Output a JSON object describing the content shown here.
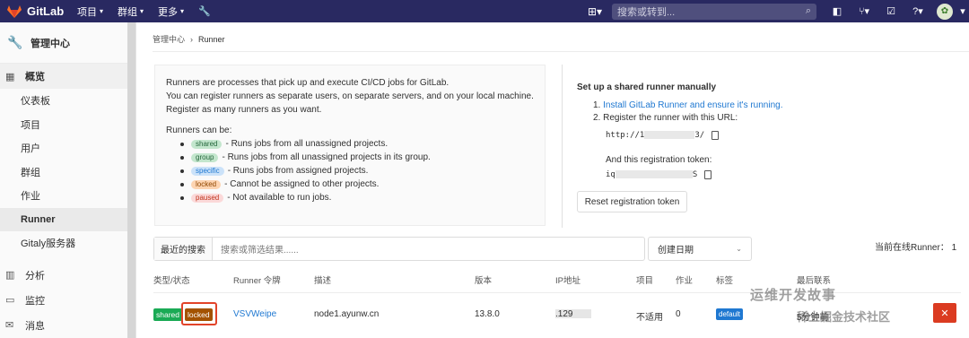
{
  "topbar": {
    "app_name": "GitLab",
    "menu": [
      {
        "label": "项目"
      },
      {
        "label": "群组"
      },
      {
        "label": "更多"
      }
    ],
    "search_placeholder": "搜索或转到..."
  },
  "sidebar": {
    "header": "管理中心",
    "section": "概览",
    "items": [
      {
        "label": "仪表板"
      },
      {
        "label": "项目"
      },
      {
        "label": "用户"
      },
      {
        "label": "群组"
      },
      {
        "label": "作业"
      },
      {
        "label": "Runner"
      },
      {
        "label": "Gitaly服务器"
      }
    ],
    "groups": [
      {
        "label": "分析"
      },
      {
        "label": "监控"
      },
      {
        "label": "消息"
      }
    ]
  },
  "breadcrumb": {
    "parent": "管理中心",
    "current": "Runner"
  },
  "info": {
    "line1": "Runners are processes that pick up and execute CI/CD jobs for GitLab.",
    "line2": "You can register runners as separate users, on separate servers, and on your local machine.",
    "line3": "Register as many runners as you want.",
    "can_be": "Runners can be:",
    "types": [
      {
        "badge": "shared",
        "text": "- Runs jobs from all unassigned projects."
      },
      {
        "badge": "group",
        "text": "- Runs jobs from all unassigned projects in its group."
      },
      {
        "badge": "specific",
        "text": "- Runs jobs from assigned projects."
      },
      {
        "badge": "locked",
        "text": "- Cannot be assigned to other projects."
      },
      {
        "badge": "paused",
        "text": "- Not available to run jobs."
      }
    ]
  },
  "setup": {
    "title": "Set up a shared runner manually",
    "step1_prefix": "1. ",
    "step1_link": "Install GitLab Runner and ensure it's running.",
    "step2": "2. Register the runner with this URL:",
    "url_start": "http://1",
    "url_end": "3/",
    "token_label": "And this registration token:",
    "token_start": "iq",
    "token_end": "S",
    "reset_button": "Reset registration token"
  },
  "filter": {
    "recent_button": "最近的搜索",
    "placeholder": "搜索或筛选结果......",
    "sort_label": "创建日期",
    "online_count_label": "当前在线Runner： 1"
  },
  "table": {
    "headers": [
      "类型/状态",
      "Runner 令牌",
      "描述",
      "版本",
      "IP地址",
      "项目",
      "作业",
      "标签",
      "最后联系"
    ],
    "row": {
      "type_shared": "shared",
      "type_locked": "locked",
      "token": "VSVWeipe",
      "description": "node1.ayunw.cn",
      "version": "13.8.0",
      "ip_suffix": ".129",
      "projects": "不适用",
      "jobs": "0",
      "tag": "default",
      "last_contact": "5分钟前"
    }
  },
  "watermark": {
    "line1": "运维开发故事",
    "line2": "稀土掘金技术社区"
  }
}
